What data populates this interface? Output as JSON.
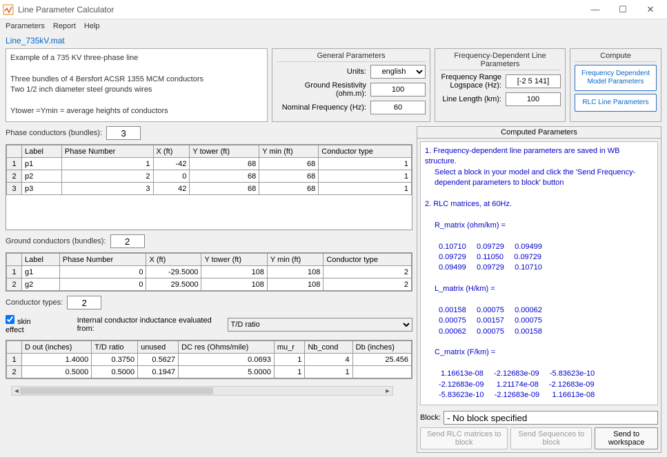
{
  "window": {
    "title": "Line Parameter Calculator"
  },
  "menu": {
    "parameters": "Parameters",
    "report": "Report",
    "help": "Help"
  },
  "file_link": "Line_735kV.mat",
  "description": {
    "l1": "Example of a 735 KV three-phase line",
    "l2": "Three bundles of 4 Bersfort ACSR 1355 MCM conductors",
    "l3": "Two 1/2 inch diameter steel grounds wires",
    "l4": "Ytower =Ymin =  average heights of conductors"
  },
  "general": {
    "title": "General Parameters",
    "units_label": "Units:",
    "units_value": "english",
    "resistivity_label": "Ground Resistivity (ohm.m):",
    "resistivity_value": "100",
    "nomfreq_label": "Nominal Frequency (Hz):",
    "nomfreq_value": "60"
  },
  "freqdep": {
    "title": "Frequency-Dependent Line Parameters",
    "range_label": "Frequency Range Logspace (Hz):",
    "range_value": "[-2 5 141]",
    "length_label": "Line Length (km):",
    "length_value": "100"
  },
  "compute": {
    "title": "Compute",
    "btn1": "Frequency Dependent Model Parameters",
    "btn2": "RLC Line Parameters"
  },
  "phase": {
    "label": "Phase conductors (bundles):",
    "count": "3",
    "headers": {
      "h0": "",
      "h1": "Label",
      "h2": "Phase Number",
      "h3": "X (ft)",
      "h4": "Y tower (ft)",
      "h5": "Y min (ft)",
      "h6": "Conductor type"
    },
    "rows": [
      {
        "idx": "1",
        "label": "p1",
        "phase": "1",
        "x": "-42",
        "yt": "68",
        "ym": "68",
        "ct": "1"
      },
      {
        "idx": "2",
        "label": "p2",
        "phase": "2",
        "x": "0",
        "yt": "68",
        "ym": "68",
        "ct": "1"
      },
      {
        "idx": "3",
        "label": "p3",
        "phase": "3",
        "x": "42",
        "yt": "68",
        "ym": "68",
        "ct": "1"
      }
    ]
  },
  "ground": {
    "label": "Ground conductors (bundles):",
    "count": "2",
    "rows": [
      {
        "idx": "1",
        "label": "g1",
        "phase": "0",
        "x": "-29.5000",
        "yt": "108",
        "ym": "108",
        "ct": "2"
      },
      {
        "idx": "2",
        "label": "g2",
        "phase": "0",
        "x": "29.5000",
        "yt": "108",
        "ym": "108",
        "ct": "2"
      }
    ]
  },
  "ctypes": {
    "label": "Conductor types:",
    "count": "2",
    "skin_label": "skin effect",
    "inductance_label": "Internal conductor inductance evaluated from:",
    "inductance_value": "T/D ratio",
    "headers": {
      "h0": "",
      "h1": "D out (inches)",
      "h2": "T/D ratio",
      "h3": "unused",
      "h4": "DC res (Ohms/mile)",
      "h5": "mu_r",
      "h6": "Nb_cond",
      "h7": "Db (inches)"
    },
    "rows": [
      {
        "idx": "1",
        "d": "1.4000",
        "td": "0.3750",
        "u": "0.5627",
        "dc": "0.0693",
        "mu": "1",
        "nb": "4",
        "db": "25.456"
      },
      {
        "idx": "2",
        "d": "0.5000",
        "td": "0.5000",
        "u": "0.1947",
        "dc": "5.0000",
        "mu": "1",
        "nb": "1",
        "db": ""
      }
    ]
  },
  "computed": {
    "title": "Computed Parameters",
    "msg1a": "1. Frequency-dependent line parameters are saved in WB structure.",
    "msg1b": "Select a block in your model and click the 'Send Frequency-dependent parameters to block' button",
    "msg2": "2. RLC matrices, at 60Hz.",
    "r_label": "R_matrix (ohm/km) =",
    "r_m": "0.10710     0.09729     0.09499\n0.09729     0.11050     0.09729\n0.09499     0.09729     0.10710",
    "l_label": "L_matrix (H/km) =",
    "l_m": "0.00158     0.00075     0.00062\n0.00075     0.00157     0.00075\n0.00062     0.00075     0.00158",
    "c_label": "C_matrix (F/km) =",
    "c_m": " 1.16613e-08     -2.12683e-09     -5.83623e-10\n-2.12683e-09      1.21174e-08     -2.12683e-09\n-5.83623e-10     -2.12683e-09      1.16613e-08",
    "block_label": "Block:",
    "block_value": "- No block specified",
    "btn_rlc": "Send RLC matrices to block",
    "btn_seq": "Send Sequences to block",
    "btn_ws": "Send to workspace"
  }
}
